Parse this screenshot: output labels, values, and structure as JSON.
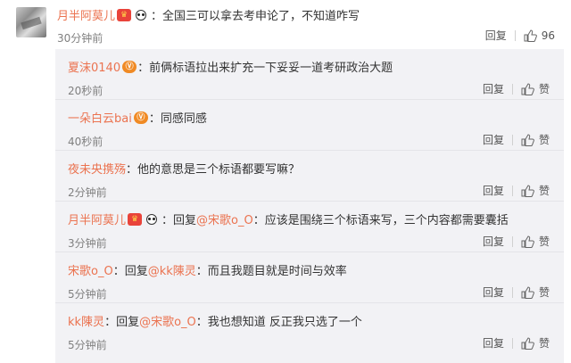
{
  "main": {
    "user": "月半阿莫儿",
    "sep": "：",
    "text": "全国三可以拿去考申论了，不知道咋写",
    "time": "30分钟前",
    "reply_label": "回复",
    "like_count": "96"
  },
  "replies": [
    {
      "user": "夏沫0140",
      "sep": "：",
      "text": "前俩标语拉出来扩充一下妥妥一道考研政治大题",
      "time": "20秒前",
      "reply_label": "回复",
      "like_label": "赞"
    },
    {
      "user": "一朵白云bai",
      "sep": "：",
      "text": "同感同感",
      "time": "40秒前",
      "reply_label": "回复",
      "like_label": "赞"
    },
    {
      "user": "夜未央携殇",
      "sep": "：",
      "text": "他的意思是三个标语都要写嘛？",
      "time": "2分钟前",
      "reply_label": "回复",
      "like_label": "赞"
    },
    {
      "user": "月半阿莫儿",
      "prefix": "回复",
      "mention": "@宋歌o_O",
      "sep": "：",
      "text": "应该是围绕三个标语来写，三个内容都需要囊括",
      "time": "3分钟前",
      "reply_label": "回复",
      "like_label": "赞"
    },
    {
      "user": "宋歌o_O",
      "sep": "：",
      "prefix": "回复",
      "mention": "@kk陳灵",
      "text": "：而且我题目就是时间与效率",
      "time": "5分钟前",
      "reply_label": "回复",
      "like_label": "赞"
    },
    {
      "user": "kk陳灵",
      "sep": "：",
      "prefix": "回复",
      "mention": "@宋歌o_O",
      "text": "：我也想知道   反正我只选了一个",
      "time": "5分钟前",
      "reply_label": "回复",
      "like_label": "赞"
    }
  ],
  "colors": {
    "username": "#eb7350",
    "panel": "#f2f2f5"
  }
}
